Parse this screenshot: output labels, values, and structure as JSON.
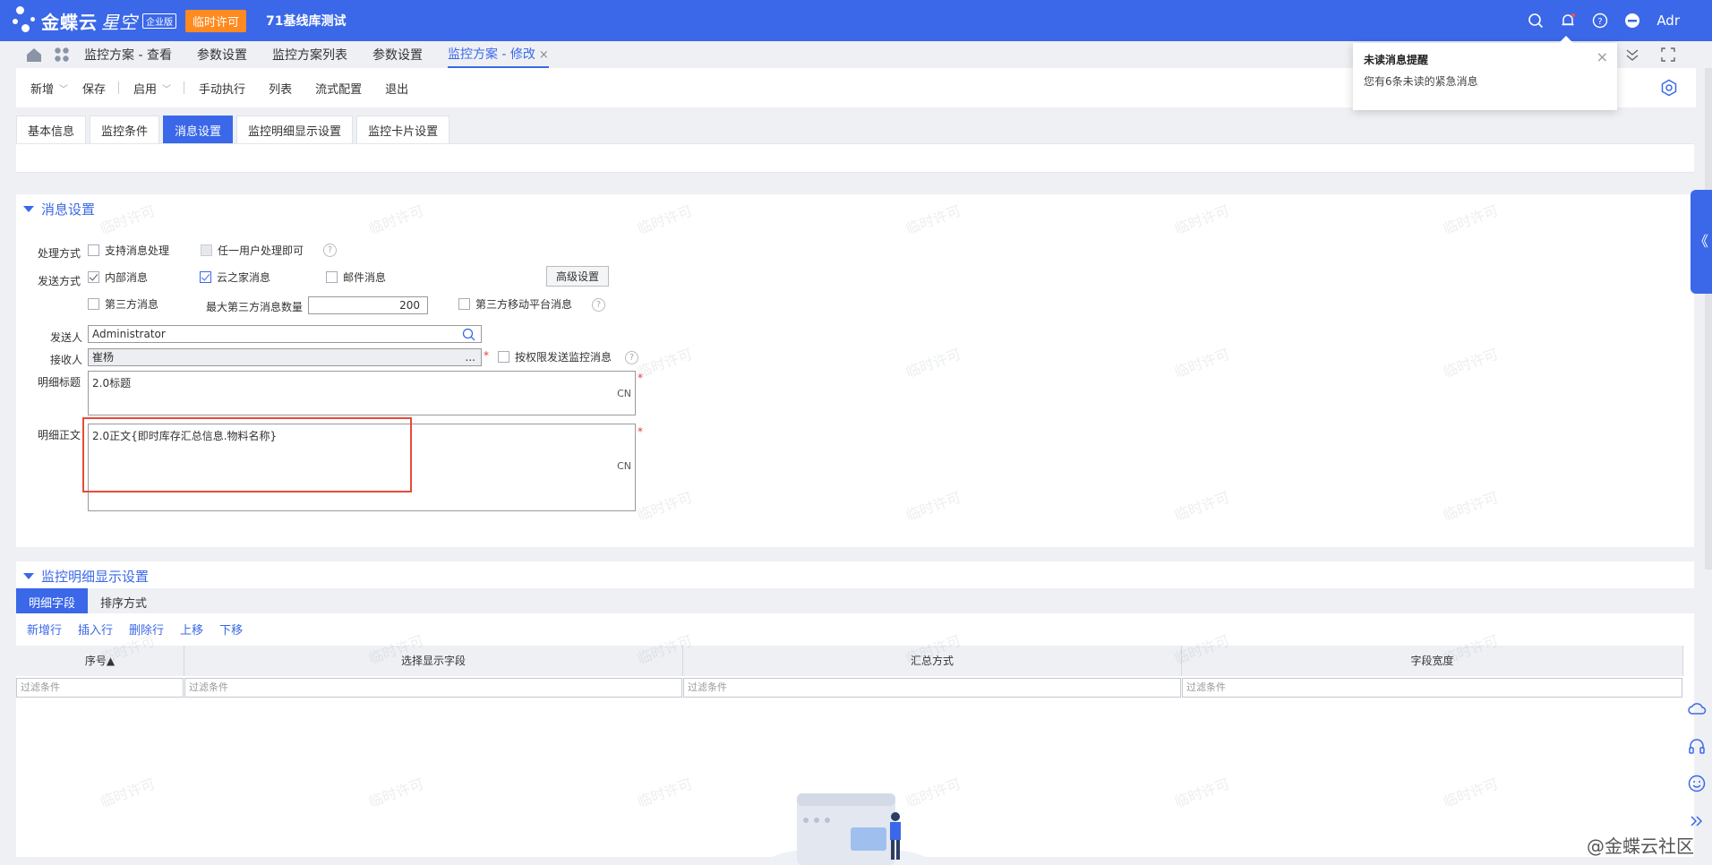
{
  "app": {
    "brand": "金蝶云",
    "brand_sub": "星空",
    "edition": "企业版",
    "license_badge": "临时许可",
    "db_name": "71基线库测试",
    "user": "Adr"
  },
  "tabs": [
    {
      "label": "监控方案 - 查看"
    },
    {
      "label": "参数设置"
    },
    {
      "label": "监控方案列表"
    },
    {
      "label": "参数设置"
    },
    {
      "label": "监控方案 - 修改",
      "active": true
    }
  ],
  "tab_close": "×",
  "toolbar": {
    "new": "新增",
    "save": "保存",
    "enable": "启用",
    "manual": "手动执行",
    "list": "列表",
    "flow": "流式配置",
    "exit": "退出"
  },
  "subtabs": [
    "基本信息",
    "监控条件",
    "消息设置",
    "监控明细显示设置",
    "监控卡片设置"
  ],
  "msg": {
    "title": "消息设置",
    "process_mode_label": "处理方式",
    "support_msg_process": "支持消息处理",
    "any_user_process": "任一用户处理即可",
    "send_mode_label": "发送方式",
    "internal_msg": "内部消息",
    "cloud_msg": "云之家消息",
    "mail_msg": "邮件消息",
    "advanced_btn": "高级设置",
    "third_party_msg": "第三方消息",
    "max_third_label": "最大第三方消息数量",
    "max_third_value": "200",
    "third_mobile_msg": "第三方移动平台消息",
    "sender_label": "发送人",
    "sender_value": "Administrator",
    "receiver_label": "接收人",
    "receiver_value": "崔杨",
    "receiver_more": "...",
    "by_permission": "按权限发送监控消息",
    "detail_title_label": "明细标题",
    "detail_title_value": "2.0标题",
    "detail_body_label": "明细正文",
    "detail_body_value": "2.0正文{即时库存汇总信息.物料名称}",
    "lang": "CN",
    "required": "*",
    "help": "?"
  },
  "detail": {
    "title": "监控明细显示设置",
    "tabs": [
      "明细字段",
      "排序方式"
    ],
    "actions": [
      "新增行",
      "插入行",
      "删除行",
      "上移",
      "下移"
    ],
    "columns": [
      "序号▲",
      "选择显示字段",
      "汇总方式",
      "字段宽度"
    ],
    "filter_placeholder": "过滤条件"
  },
  "popup": {
    "title": "未读消息提醒",
    "body": "您有6条未读的紧急消息",
    "close": "×"
  },
  "watermark": "临时许可",
  "side_tab": "《",
  "community": "@金蝶云社区",
  "colors": {
    "primary": "#3b68e8",
    "badge": "#ff8a1f",
    "highlight": "#e84b3a",
    "required": "#e23b3b"
  }
}
